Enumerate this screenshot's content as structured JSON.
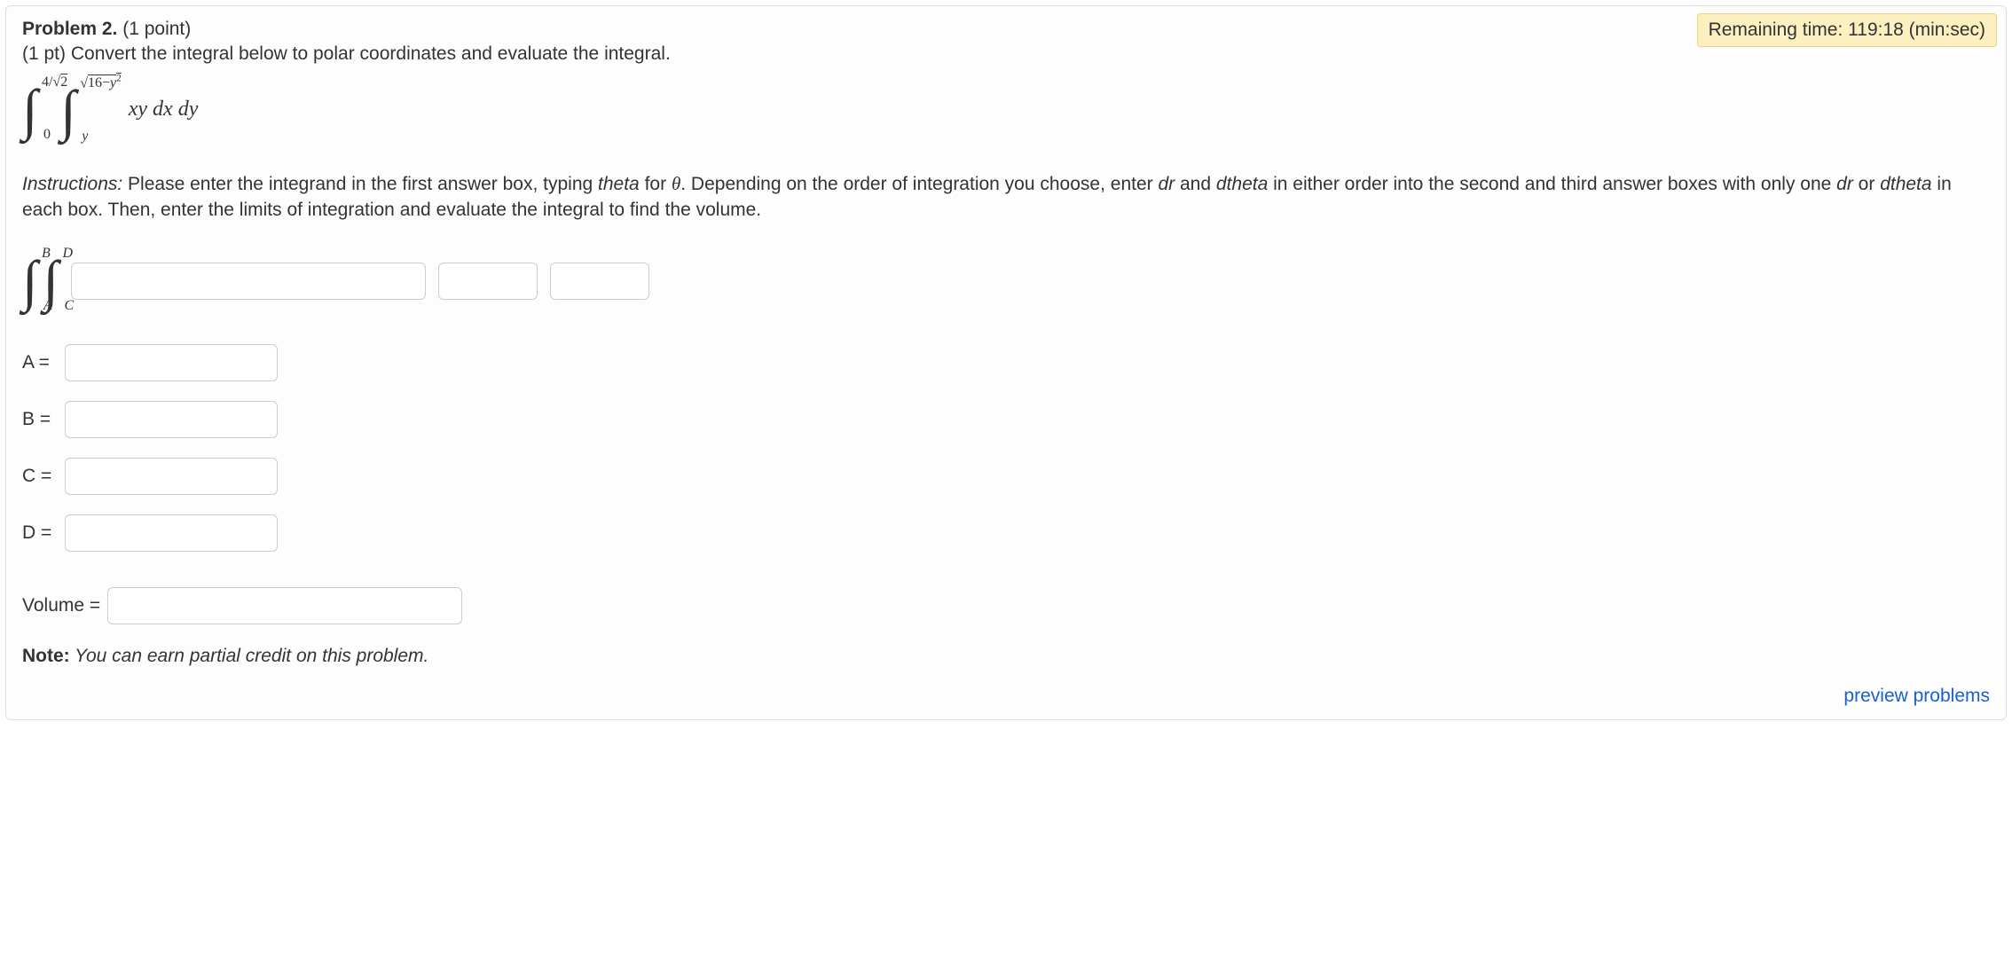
{
  "timer": {
    "label": "Remaining time:",
    "value": "119:18",
    "unit": "(min:sec)"
  },
  "problem": {
    "title_bold": "Problem 2.",
    "title_rest": "(1 point)",
    "prompt": "(1 pt) Convert the integral below to polar coordinates and evaluate the integral.",
    "outer_upper_pre": "4/",
    "outer_upper_sqrt": "2",
    "outer_lower": "0",
    "inner_upper_sqrt_pre": "16−",
    "inner_upper_sqrt_var": "y",
    "inner_upper_sqrt_exp": "2",
    "inner_lower": "y",
    "integrand": "xy dx dy"
  },
  "instructions": {
    "lead": "Instructions:",
    "body1": " Please enter the integrand in the first answer box, typing ",
    "theta_word": "theta",
    "body2": " for ",
    "theta_sym": "θ",
    "body3": ". Depending on the order of integration you choose, enter ",
    "dr": "dr",
    "body4": " and ",
    "dtheta": "dtheta",
    "body5": " in either order into the second and third answer boxes with only one ",
    "body6": " or ",
    "body7": " in each box. Then, enter the limits of integration and evaluate the integral to find the volume."
  },
  "template": {
    "outer_upper": "B",
    "outer_lower": "A",
    "inner_upper": "D",
    "inner_lower": "C"
  },
  "limits": {
    "A": "A =",
    "B": "B =",
    "C": "C =",
    "D": "D ="
  },
  "volume_label": "Volume =",
  "note": {
    "bold": "Note:",
    "rest": " You can earn partial credit on this problem."
  },
  "preview": "preview problems"
}
